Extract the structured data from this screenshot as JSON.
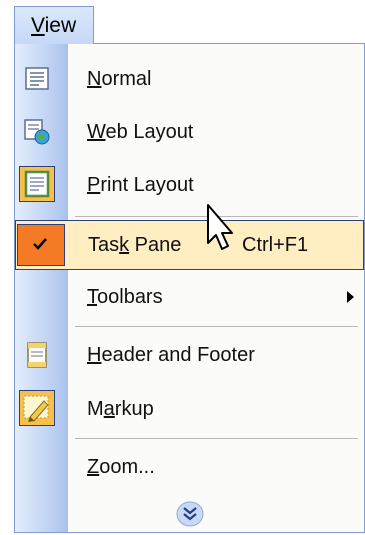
{
  "menubar": {
    "title_underlined": "V",
    "title_rest": "iew"
  },
  "menu": {
    "items": [
      {
        "u": "N",
        "rest": "ormal",
        "icon": "normal-view-icon"
      },
      {
        "u": "W",
        "rest": "eb Layout",
        "icon": "web-layout-icon"
      },
      {
        "u": "P",
        "rest": "rint Layout",
        "icon": "print-layout-icon"
      },
      {
        "pre": "Tas",
        "u": "k",
        "rest": " Pane",
        "shortcut": "Ctrl+F1",
        "checked": true,
        "highlighted": true
      },
      {
        "u": "T",
        "rest": "oolbars",
        "submenu": true
      },
      {
        "u": "H",
        "rest": "eader and Footer",
        "icon": "header-footer-icon"
      },
      {
        "pre": "M",
        "u": "a",
        "rest": "rkup",
        "icon": "markup-icon"
      },
      {
        "u": "Z",
        "rest": "oom...",
        "icon": ""
      }
    ],
    "expand_icon": "chevron-double-down-icon"
  },
  "colors": {
    "highlight_bg": "#ffeec2",
    "highlight_border": "#2c3f7a",
    "check_bg": "#f47a25",
    "strip": "#bcd0f2"
  }
}
